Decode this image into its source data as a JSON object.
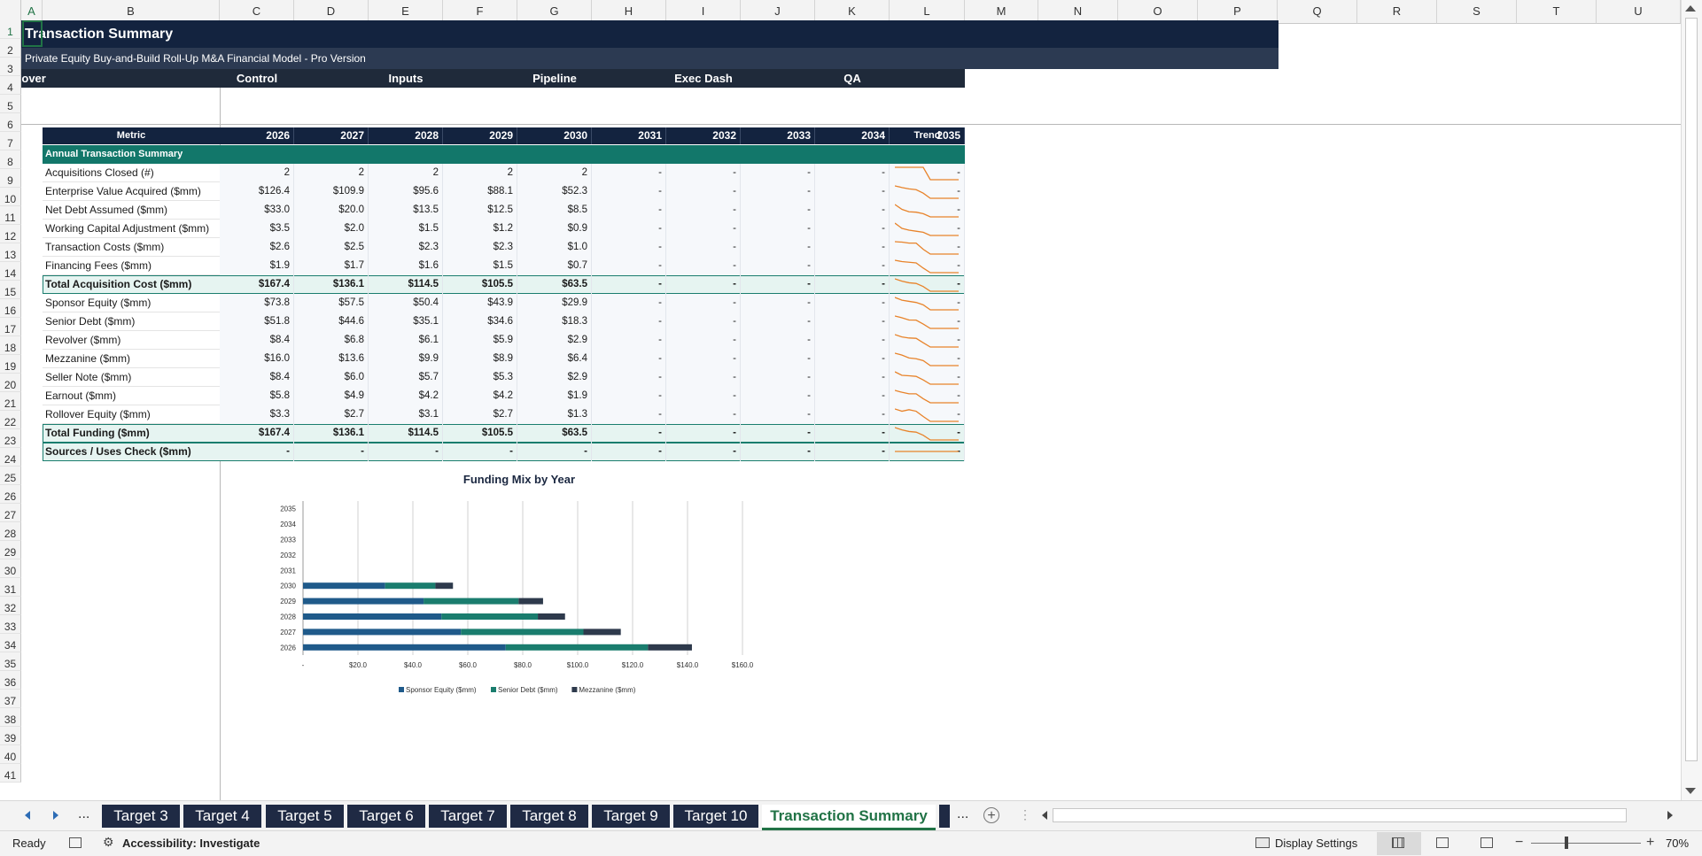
{
  "columns": [
    "A",
    "B",
    "C",
    "D",
    "E",
    "F",
    "G",
    "H",
    "I",
    "J",
    "K",
    "L",
    "M",
    "N",
    "O",
    "P",
    "Q",
    "R",
    "S",
    "T",
    "U"
  ],
  "rows": [
    "1",
    "2",
    "3",
    "4",
    "5",
    "6",
    "7",
    "8",
    "9",
    "10",
    "11",
    "12",
    "13",
    "14",
    "15",
    "16",
    "17",
    "18",
    "19",
    "20",
    "21",
    "22",
    "23",
    "24",
    "25",
    "26",
    "27",
    "28",
    "29",
    "30",
    "31",
    "32",
    "33",
    "34",
    "35",
    "36",
    "37",
    "38",
    "39",
    "40",
    "41"
  ],
  "title": "Transaction Summary",
  "subtitle": "Private Equity Buy-and-Build Roll-Up M&A Financial Model - Pro Version",
  "nav": [
    "Cover",
    "Control",
    "Inputs",
    "Pipeline",
    "Exec Dash",
    "QA"
  ],
  "table": {
    "metric_header": "Metric",
    "years": [
      "2026",
      "2027",
      "2028",
      "2029",
      "2030",
      "2031",
      "2032",
      "2033",
      "2034",
      "2035"
    ],
    "trend_header": "Trend",
    "section": "Annual Transaction Summary",
    "rows": [
      {
        "label": "Acquisitions Closed (#)",
        "values": [
          "2",
          "2",
          "2",
          "2",
          "2",
          "-",
          "-",
          "-",
          "-",
          "-"
        ]
      },
      {
        "label": "Enterprise Value Acquired ($mm)",
        "values": [
          "$126.4",
          "$109.9",
          "$95.6",
          "$88.1",
          "$52.3",
          "-",
          "-",
          "-",
          "-",
          "-"
        ]
      },
      {
        "label": "Net Debt Assumed ($mm)",
        "values": [
          "$33.0",
          "$20.0",
          "$13.5",
          "$12.5",
          "$8.5",
          "-",
          "-",
          "-",
          "-",
          "-"
        ]
      },
      {
        "label": "Working Capital Adjustment ($mm)",
        "values": [
          "$3.5",
          "$2.0",
          "$1.5",
          "$1.2",
          "$0.9",
          "-",
          "-",
          "-",
          "-",
          "-"
        ]
      },
      {
        "label": "Transaction Costs ($mm)",
        "values": [
          "$2.6",
          "$2.5",
          "$2.3",
          "$2.3",
          "$1.0",
          "-",
          "-",
          "-",
          "-",
          "-"
        ]
      },
      {
        "label": "Financing Fees ($mm)",
        "values": [
          "$1.9",
          "$1.7",
          "$1.6",
          "$1.5",
          "$0.7",
          "-",
          "-",
          "-",
          "-",
          "-"
        ]
      },
      {
        "label": "Total Acquisition Cost ($mm)",
        "values": [
          "$167.4",
          "$136.1",
          "$114.5",
          "$105.5",
          "$63.5",
          "-",
          "-",
          "-",
          "-",
          "-"
        ],
        "total": true
      },
      {
        "label": "Sponsor Equity ($mm)",
        "values": [
          "$73.8",
          "$57.5",
          "$50.4",
          "$43.9",
          "$29.9",
          "-",
          "-",
          "-",
          "-",
          "-"
        ]
      },
      {
        "label": "Senior Debt ($mm)",
        "values": [
          "$51.8",
          "$44.6",
          "$35.1",
          "$34.6",
          "$18.3",
          "-",
          "-",
          "-",
          "-",
          "-"
        ]
      },
      {
        "label": "Revolver ($mm)",
        "values": [
          "$8.4",
          "$6.8",
          "$6.1",
          "$5.9",
          "$2.9",
          "-",
          "-",
          "-",
          "-",
          "-"
        ]
      },
      {
        "label": "Mezzanine ($mm)",
        "values": [
          "$16.0",
          "$13.6",
          "$9.9",
          "$8.9",
          "$6.4",
          "-",
          "-",
          "-",
          "-",
          "-"
        ]
      },
      {
        "label": "Seller Note ($mm)",
        "values": [
          "$8.4",
          "$6.0",
          "$5.7",
          "$5.3",
          "$2.9",
          "-",
          "-",
          "-",
          "-",
          "-"
        ]
      },
      {
        "label": "Earnout ($mm)",
        "values": [
          "$5.8",
          "$4.9",
          "$4.2",
          "$4.2",
          "$1.9",
          "-",
          "-",
          "-",
          "-",
          "-"
        ]
      },
      {
        "label": "Rollover Equity ($mm)",
        "values": [
          "$3.3",
          "$2.7",
          "$3.1",
          "$2.7",
          "$1.3",
          "-",
          "-",
          "-",
          "-",
          "-"
        ]
      },
      {
        "label": "Total Funding ($mm)",
        "values": [
          "$167.4",
          "$136.1",
          "$114.5",
          "$105.5",
          "$63.5",
          "-",
          "-",
          "-",
          "-",
          "-"
        ],
        "total": true
      },
      {
        "label": "Sources / Uses Check ($mm)",
        "values": [
          "-",
          "-",
          "-",
          "-",
          "-",
          "-",
          "-",
          "-",
          "-",
          "-"
        ],
        "total": true
      }
    ]
  },
  "chart_data": {
    "type": "bar",
    "orientation": "horizontal",
    "stacked": true,
    "title": "Funding Mix by Year",
    "categories": [
      "2026",
      "2027",
      "2028",
      "2029",
      "2030",
      "2031",
      "2032",
      "2033",
      "2034",
      "2035"
    ],
    "series": [
      {
        "name": "Sponsor Equity ($mm)",
        "values": [
          73.8,
          57.5,
          50.4,
          43.9,
          29.9,
          0,
          0,
          0,
          0,
          0
        ],
        "color": "#1f5a8a"
      },
      {
        "name": "Senior Debt ($mm)",
        "values": [
          51.8,
          44.6,
          35.1,
          34.6,
          18.3,
          0,
          0,
          0,
          0,
          0
        ],
        "color": "#1a7d6e"
      },
      {
        "name": "Mezzanine ($mm)",
        "values": [
          16.0,
          13.6,
          9.9,
          8.9,
          6.4,
          0,
          0,
          0,
          0,
          0
        ],
        "color": "#2e3a4c"
      }
    ],
    "xlim": [
      0,
      160
    ],
    "xticks": [
      "-",
      "$20.0",
      "$40.0",
      "$60.0",
      "$80.0",
      "$100.0",
      "$120.0",
      "$140.0",
      "$160.0"
    ],
    "legend_position": "bottom",
    "grid": true
  },
  "tabs": {
    "sheets": [
      "Target 3",
      "Target 4",
      "Target 5",
      "Target 6",
      "Target 7",
      "Target 8",
      "Target 9",
      "Target 10",
      "Transaction Summary"
    ],
    "more": "..."
  },
  "status": {
    "ready": "Ready",
    "accessibility": "Accessibility: Investigate",
    "display_settings": "Display Settings",
    "zoom": "70%"
  },
  "colors": {
    "navy": "#13233f",
    "teal": "#12776a",
    "trend": "#e8832a",
    "excel_green": "#217346"
  }
}
